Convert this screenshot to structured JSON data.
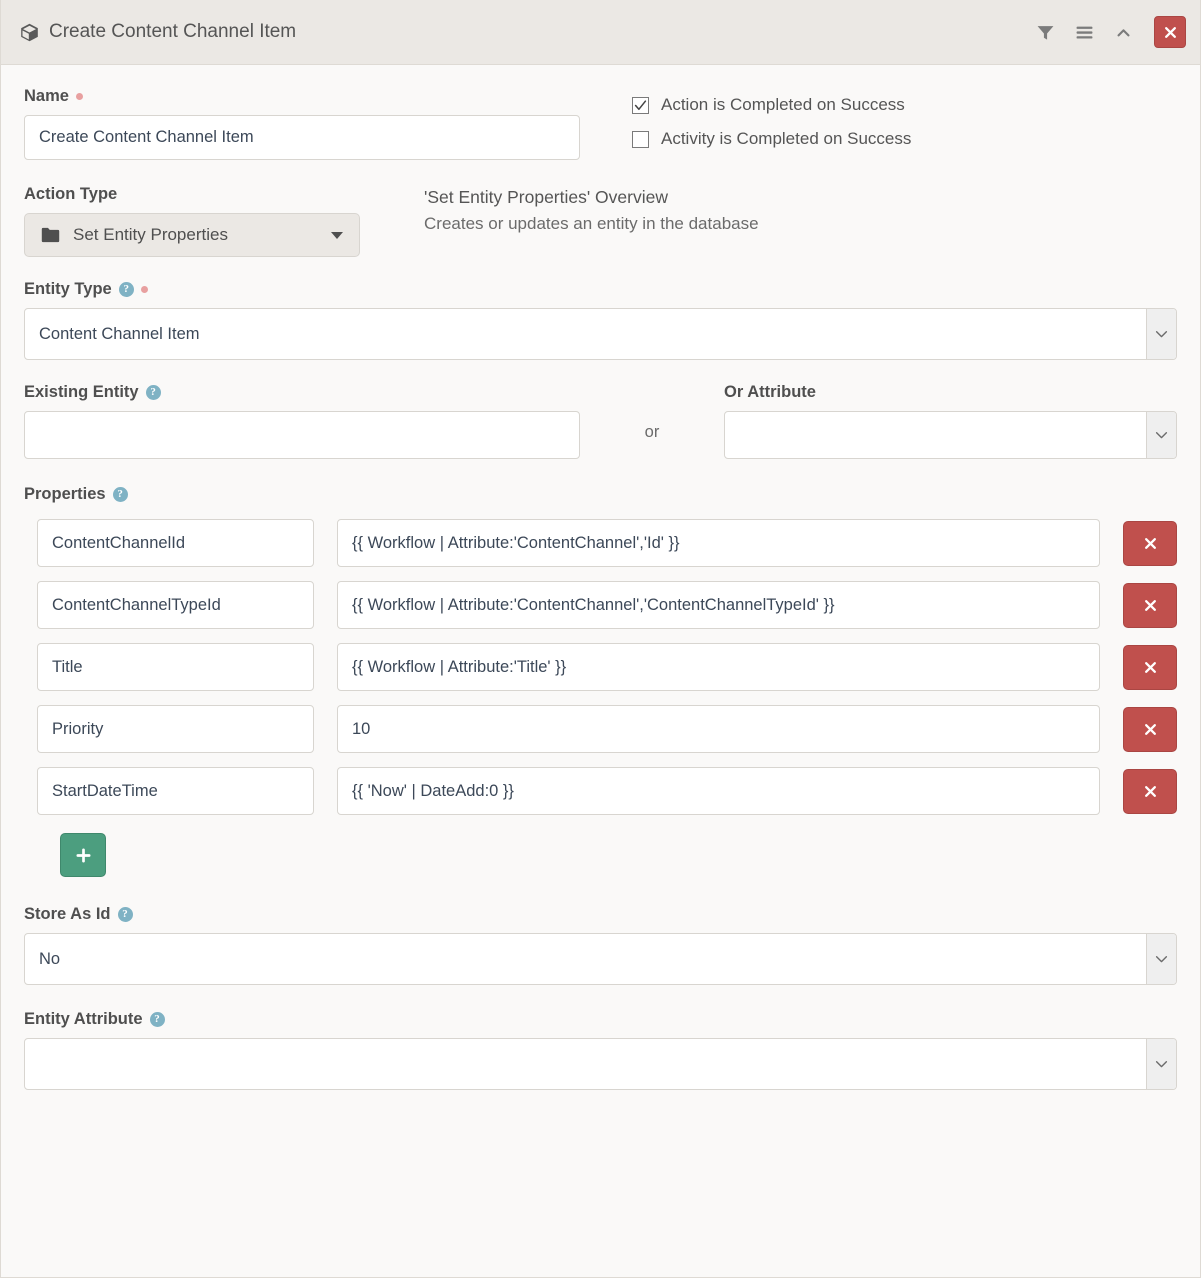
{
  "header": {
    "title": "Create Content Channel Item",
    "icon": "cube-icon",
    "tools": [
      {
        "name": "filter-icon",
        "label": "Filter"
      },
      {
        "name": "reorder-icon",
        "label": "Reorder"
      },
      {
        "name": "collapse-icon",
        "label": "Collapse"
      }
    ],
    "close_label": "✕"
  },
  "name_field": {
    "label": "Name",
    "value": "Create Content Channel Item",
    "required": true
  },
  "options": [
    {
      "label": "Action is Completed on Success",
      "checked": true
    },
    {
      "label": "Activity is Completed on Success",
      "checked": false
    }
  ],
  "action_type": {
    "label": "Action Type",
    "selected": "Set Entity Properties",
    "icon": "folder-icon"
  },
  "overview": {
    "title": "'Set Entity Properties' Overview",
    "description": "Creates or updates an entity in the database"
  },
  "entity_type": {
    "label": "Entity Type",
    "value": "Content Channel Item",
    "required": true,
    "help": "?"
  },
  "existing_entity": {
    "label": "Existing Entity",
    "value": "",
    "help": "?"
  },
  "or_separator": "or",
  "or_attribute": {
    "label": "Or Attribute",
    "value": ""
  },
  "properties": {
    "label": "Properties",
    "help": "?",
    "delete_label": "✕",
    "add_label": "+",
    "rows": [
      {
        "key": "ContentChannelId",
        "value": "{{ Workflow | Attribute:'ContentChannel','Id' }}"
      },
      {
        "key": "ContentChannelTypeId",
        "value": "{{ Workflow | Attribute:'ContentChannel','ContentChannelTypeId' }}"
      },
      {
        "key": "Title",
        "value": "{{ Workflow | Attribute:'Title' }}"
      },
      {
        "key": "Priority",
        "value": "10"
      },
      {
        "key": "StartDateTime",
        "value": "{{ 'Now' | DateAdd:0 }}"
      }
    ]
  },
  "store_as_id": {
    "label": "Store As Id",
    "value": "No",
    "help": "?"
  },
  "entity_attribute": {
    "label": "Entity Attribute",
    "value": "",
    "help": "?"
  },
  "colors": {
    "header_bg": "#EBE8E4",
    "body_bg": "#FAF9F8",
    "danger": "#C0504D",
    "success": "#4C9E7F",
    "help": "#7FB2C4",
    "required_dot": "#E8A0A0"
  }
}
